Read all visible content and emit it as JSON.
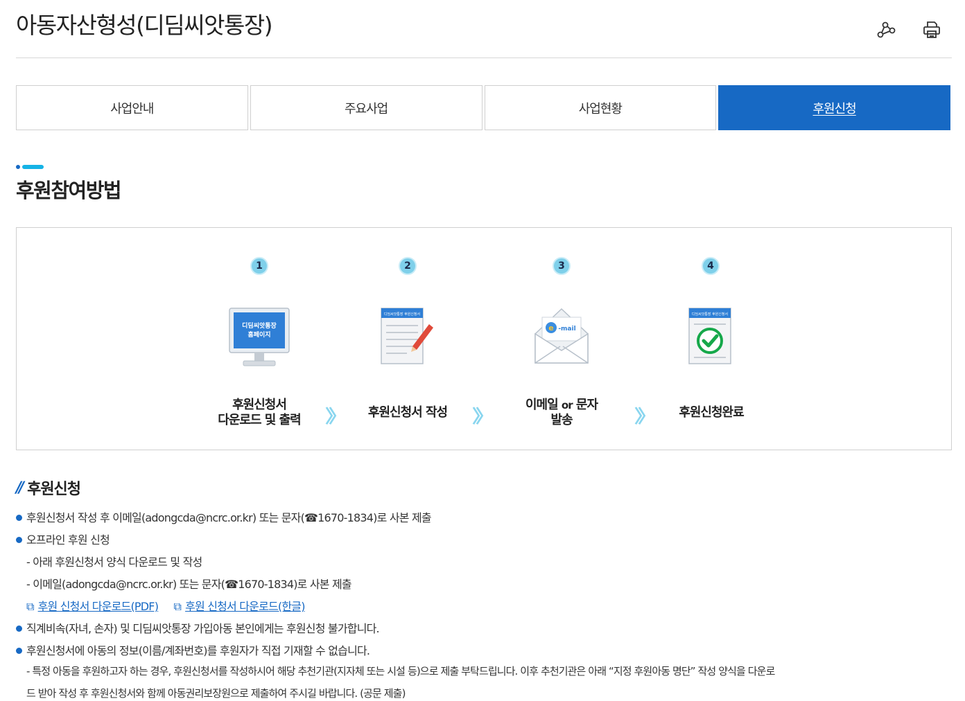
{
  "header": {
    "title": "아동자산형성(디딤씨앗통장)",
    "share_icon": "share-icon",
    "print_icon": "print-icon"
  },
  "tabs": [
    {
      "label": "사업안내",
      "active": false
    },
    {
      "label": "주요사업",
      "active": false
    },
    {
      "label": "사업현황",
      "active": false
    },
    {
      "label": "후원신청",
      "active": true
    }
  ],
  "section": {
    "title": "후원참여방법"
  },
  "steps": [
    {
      "num": "1",
      "label_line1": "후원신청서",
      "label_line2": "다운로드 및 출력",
      "icon": "monitor-icon",
      "icon_text_1": "디딤씨앗통장",
      "icon_text_2": "홈페이지"
    },
    {
      "num": "2",
      "label_line1": "후원신청서 작성",
      "icon": "form-pencil-icon",
      "icon_text_1": "디딤씨앗통장 후원신청서"
    },
    {
      "num": "3",
      "label_pre": "이메일 ",
      "label_or": "or",
      "label_post": " 문자",
      "label_line2": "발송",
      "icon": "mail-envelope-icon",
      "icon_text_1": "-mail"
    },
    {
      "num": "4",
      "label_line1": "후원신청완료",
      "icon": "form-check-icon",
      "icon_text_1": "디딤씨앗통장 후원신청서"
    }
  ],
  "apply": {
    "title": "후원신청",
    "lines": {
      "l1": "후원신청서 작성 후 이메일(adongcda@ncrc.or.kr) 또는 문자(☎1670-1834)로 사본 제출",
      "l2": "오프라인 후원 신청",
      "l3": "- 아래 후원신청서 양식 다운로드 및 작성",
      "l4": "- 이메일(adongcda@ncrc.or.kr) 또는 문자(☎1670-1834)로 사본 제출",
      "link_pdf": "후원 신청서 다운로드(PDF)",
      "link_hwp": "후원 신청서 다운로드(한글)",
      "l6": "직계비속(자녀, 손자) 및 디딤씨앗통장 가입아동 본인에게는 후원신청 불가합니다.",
      "l7": "후원신청서에 아동의 정보(이름/계좌번호)를 후원자가 직접 기재할 수 없습니다.",
      "l8": "- 특정 아동을 후원하고자 하는 경우, 후원신청서를 작성하시어 해당 추천기관(지자체 또는 시설 등)으로 제출 부탁드립니다. 이후 추천기관은 아래 “지정 후원아동 명단” 작성 양식을 다운로",
      "l9": "드 받아 작성 후 후원신청서와 함께 아동권리보장원으로 제출하여 주시길 바랍니다. (공문 제출)"
    }
  },
  "colors": {
    "accent": "#1769c4",
    "accent_light": "#15b3e6",
    "step_circle": "#7fd0ea"
  }
}
